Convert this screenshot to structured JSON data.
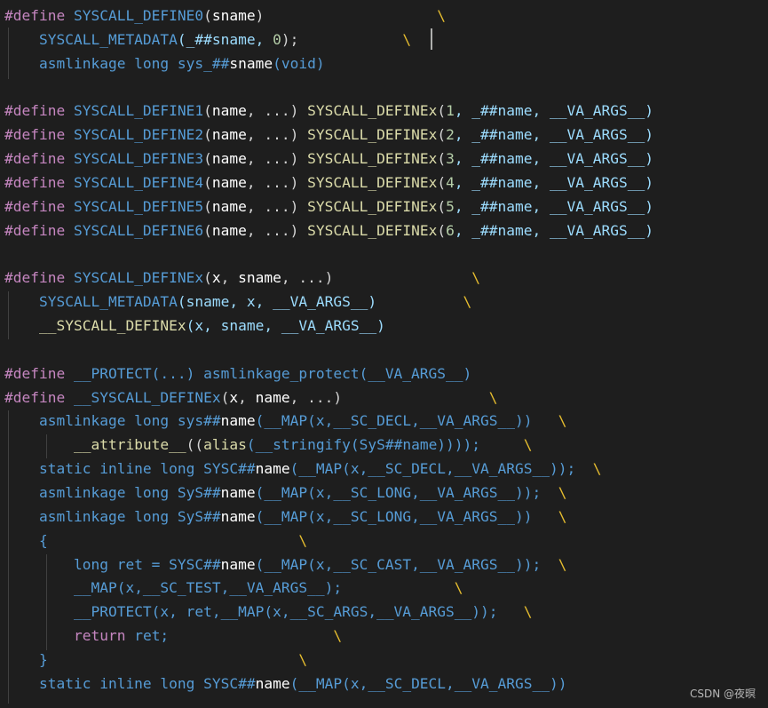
{
  "editor": {
    "lines": [
      [
        {
          "t": "#define ",
          "c": "macro"
        },
        {
          "t": "SYSCALL_DEFINE0",
          "c": "kw"
        },
        {
          "t": "(",
          "c": "plain"
        },
        {
          "t": "sname",
          "c": "bold"
        },
        {
          "t": ")",
          "c": "plain"
        },
        {
          "t": "                    \\",
          "c": "cont"
        }
      ],
      [
        {
          "t": "    ",
          "c": "plain"
        },
        {
          "t": "SYSCALL_METADATA",
          "c": "kw"
        },
        {
          "t": "(_##sname, ",
          "c": "param"
        },
        {
          "t": "0",
          "c": "num"
        },
        {
          "t": ");",
          "c": "plain"
        },
        {
          "t": "            \\",
          "c": "cont"
        }
      ],
      [
        {
          "t": "    ",
          "c": "plain"
        },
        {
          "t": "asmlinkage long sys_##",
          "c": "kw"
        },
        {
          "t": "sname",
          "c": "bold"
        },
        {
          "t": "(void)",
          "c": "kw"
        }
      ],
      [],
      [
        {
          "t": "#define ",
          "c": "macro"
        },
        {
          "t": "SYSCALL_DEFINE1",
          "c": "kw"
        },
        {
          "t": "(",
          "c": "plain"
        },
        {
          "t": "name",
          "c": "bold"
        },
        {
          "t": ", ...) ",
          "c": "plain"
        },
        {
          "t": "SYSCALL_DEFINEx",
          "c": "fn"
        },
        {
          "t": "(",
          "c": "plain"
        },
        {
          "t": "1",
          "c": "num"
        },
        {
          "t": ", _##name, __VA_ARGS__)",
          "c": "param"
        }
      ],
      [
        {
          "t": "#define ",
          "c": "macro"
        },
        {
          "t": "SYSCALL_DEFINE2",
          "c": "kw"
        },
        {
          "t": "(",
          "c": "plain"
        },
        {
          "t": "name",
          "c": "bold"
        },
        {
          "t": ", ...) ",
          "c": "plain"
        },
        {
          "t": "SYSCALL_DEFINEx",
          "c": "fn"
        },
        {
          "t": "(",
          "c": "plain"
        },
        {
          "t": "2",
          "c": "num"
        },
        {
          "t": ", _##name, __VA_ARGS__)",
          "c": "param"
        }
      ],
      [
        {
          "t": "#define ",
          "c": "macro"
        },
        {
          "t": "SYSCALL_DEFINE3",
          "c": "kw"
        },
        {
          "t": "(",
          "c": "plain"
        },
        {
          "t": "name",
          "c": "bold"
        },
        {
          "t": ", ...) ",
          "c": "plain"
        },
        {
          "t": "SYSCALL_DEFINEx",
          "c": "fn"
        },
        {
          "t": "(",
          "c": "plain"
        },
        {
          "t": "3",
          "c": "num"
        },
        {
          "t": ", _##name, __VA_ARGS__)",
          "c": "param"
        }
      ],
      [
        {
          "t": "#define ",
          "c": "macro"
        },
        {
          "t": "SYSCALL_DEFINE4",
          "c": "kw"
        },
        {
          "t": "(",
          "c": "plain"
        },
        {
          "t": "name",
          "c": "bold"
        },
        {
          "t": ", ...) ",
          "c": "plain"
        },
        {
          "t": "SYSCALL_DEFINEx",
          "c": "fn"
        },
        {
          "t": "(",
          "c": "plain"
        },
        {
          "t": "4",
          "c": "num"
        },
        {
          "t": ", _##name, __VA_ARGS__)",
          "c": "param"
        }
      ],
      [
        {
          "t": "#define ",
          "c": "macro"
        },
        {
          "t": "SYSCALL_DEFINE5",
          "c": "kw"
        },
        {
          "t": "(",
          "c": "plain"
        },
        {
          "t": "name",
          "c": "bold"
        },
        {
          "t": ", ...) ",
          "c": "plain"
        },
        {
          "t": "SYSCALL_DEFINEx",
          "c": "fn"
        },
        {
          "t": "(",
          "c": "plain"
        },
        {
          "t": "5",
          "c": "num"
        },
        {
          "t": ", _##name, __VA_ARGS__)",
          "c": "param"
        }
      ],
      [
        {
          "t": "#define ",
          "c": "macro"
        },
        {
          "t": "SYSCALL_DEFINE6",
          "c": "kw"
        },
        {
          "t": "(",
          "c": "plain"
        },
        {
          "t": "name",
          "c": "bold"
        },
        {
          "t": ", ...) ",
          "c": "plain"
        },
        {
          "t": "SYSCALL_DEFINEx",
          "c": "fn"
        },
        {
          "t": "(",
          "c": "plain"
        },
        {
          "t": "6",
          "c": "num"
        },
        {
          "t": ", _##name, __VA_ARGS__)",
          "c": "param"
        }
      ],
      [],
      [
        {
          "t": "#define ",
          "c": "macro"
        },
        {
          "t": "SYSCALL_DEFINEx",
          "c": "kw"
        },
        {
          "t": "(",
          "c": "plain"
        },
        {
          "t": "x",
          "c": "bold"
        },
        {
          "t": ", ",
          "c": "plain"
        },
        {
          "t": "sname",
          "c": "bold"
        },
        {
          "t": ", ...)",
          "c": "plain"
        },
        {
          "t": "                \\",
          "c": "cont"
        }
      ],
      [
        {
          "t": "    ",
          "c": "plain"
        },
        {
          "t": "SYSCALL_METADATA",
          "c": "kw"
        },
        {
          "t": "(sname, x, __VA_ARGS__)",
          "c": "param"
        },
        {
          "t": "          \\",
          "c": "cont"
        }
      ],
      [
        {
          "t": "    ",
          "c": "plain"
        },
        {
          "t": "__SYSCALL_DEFINEx",
          "c": "fn"
        },
        {
          "t": "(x, sname, __VA_ARGS__)",
          "c": "param"
        }
      ],
      [],
      [
        {
          "t": "#define ",
          "c": "macro"
        },
        {
          "t": "__PROTECT(...) asmlinkage_protect(__VA_ARGS__)",
          "c": "kw"
        }
      ],
      [
        {
          "t": "#define ",
          "c": "macro"
        },
        {
          "t": "__SYSCALL_DEFINEx",
          "c": "kw"
        },
        {
          "t": "(",
          "c": "plain"
        },
        {
          "t": "x",
          "c": "bold"
        },
        {
          "t": ", ",
          "c": "plain"
        },
        {
          "t": "name",
          "c": "bold"
        },
        {
          "t": ", ...)",
          "c": "plain"
        },
        {
          "t": "                 \\",
          "c": "cont"
        }
      ],
      [
        {
          "t": "    ",
          "c": "plain"
        },
        {
          "t": "asmlinkage long sys##",
          "c": "kw"
        },
        {
          "t": "name",
          "c": "bold"
        },
        {
          "t": "(__MAP(x,__SC_DECL,__VA_ARGS__))",
          "c": "kw"
        },
        {
          "t": "   \\",
          "c": "cont"
        }
      ],
      [
        {
          "t": "        ",
          "c": "plain"
        },
        {
          "t": "__attribute__",
          "c": "fn"
        },
        {
          "t": "((",
          "c": "plain"
        },
        {
          "t": "alias",
          "c": "fn"
        },
        {
          "t": "(__stringify(SyS##name))));",
          "c": "kw"
        },
        {
          "t": "     \\",
          "c": "cont"
        }
      ],
      [
        {
          "t": "    ",
          "c": "plain"
        },
        {
          "t": "static inline long SYSC##",
          "c": "kw"
        },
        {
          "t": "name",
          "c": "bold"
        },
        {
          "t": "(__MAP(x,__SC_DECL,__VA_ARGS__));",
          "c": "kw"
        },
        {
          "t": "  \\",
          "c": "cont"
        }
      ],
      [
        {
          "t": "    ",
          "c": "plain"
        },
        {
          "t": "asmlinkage long SyS##",
          "c": "kw"
        },
        {
          "t": "name",
          "c": "bold"
        },
        {
          "t": "(__MAP(x,__SC_LONG,__VA_ARGS__));",
          "c": "kw"
        },
        {
          "t": "  \\",
          "c": "cont"
        }
      ],
      [
        {
          "t": "    ",
          "c": "plain"
        },
        {
          "t": "asmlinkage long SyS##",
          "c": "kw"
        },
        {
          "t": "name",
          "c": "bold"
        },
        {
          "t": "(__MAP(x,__SC_LONG,__VA_ARGS__))",
          "c": "kw"
        },
        {
          "t": "   \\",
          "c": "cont"
        }
      ],
      [
        {
          "t": "    {",
          "c": "kw"
        },
        {
          "t": "                             \\",
          "c": "cont"
        }
      ],
      [
        {
          "t": "        ",
          "c": "plain"
        },
        {
          "t": "long ret = SYSC##",
          "c": "kw"
        },
        {
          "t": "name",
          "c": "bold"
        },
        {
          "t": "(__MAP(x,__SC_CAST,__VA_ARGS__));",
          "c": "kw"
        },
        {
          "t": "  \\",
          "c": "cont"
        }
      ],
      [
        {
          "t": "        ",
          "c": "plain"
        },
        {
          "t": "__MAP(x,__SC_TEST,__VA_ARGS__);",
          "c": "kw"
        },
        {
          "t": "             \\",
          "c": "cont"
        }
      ],
      [
        {
          "t": "        ",
          "c": "plain"
        },
        {
          "t": "__PROTECT(x, ret,__MAP(x,__SC_ARGS,__VA_ARGS__));",
          "c": "kw"
        },
        {
          "t": "   \\",
          "c": "cont"
        }
      ],
      [
        {
          "t": "        ",
          "c": "plain"
        },
        {
          "t": "return",
          "c": "ctrl"
        },
        {
          "t": " ret;",
          "c": "kw"
        },
        {
          "t": "                   \\",
          "c": "cont"
        }
      ],
      [
        {
          "t": "    }",
          "c": "kw"
        },
        {
          "t": "                             \\",
          "c": "cont"
        }
      ],
      [
        {
          "t": "    ",
          "c": "plain"
        },
        {
          "t": "static inline long SYSC##",
          "c": "kw"
        },
        {
          "t": "name",
          "c": "bold"
        },
        {
          "t": "(__MAP(x,__SC_DECL,__VA_ARGS__))",
          "c": "kw"
        }
      ]
    ]
  },
  "watermark": "CSDN @夜暝"
}
